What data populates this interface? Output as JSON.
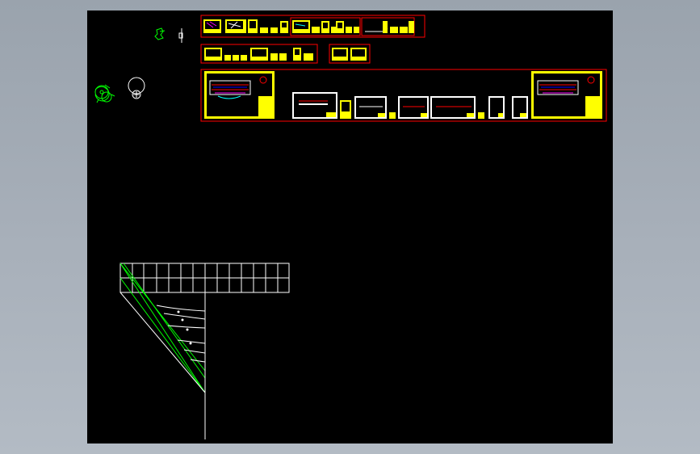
{
  "colors": {
    "background": "#9aa3ad",
    "modelspace": "#000000",
    "frame": "#ff0000",
    "sheet_fill": "#ffff00",
    "linework": "#ffffff",
    "construction": "#00ff00",
    "accent_magenta": "#ff00ff",
    "accent_cyan": "#00ffff",
    "accent_blue": "#0000ff"
  },
  "viewport": {
    "name": "CAD model space"
  }
}
